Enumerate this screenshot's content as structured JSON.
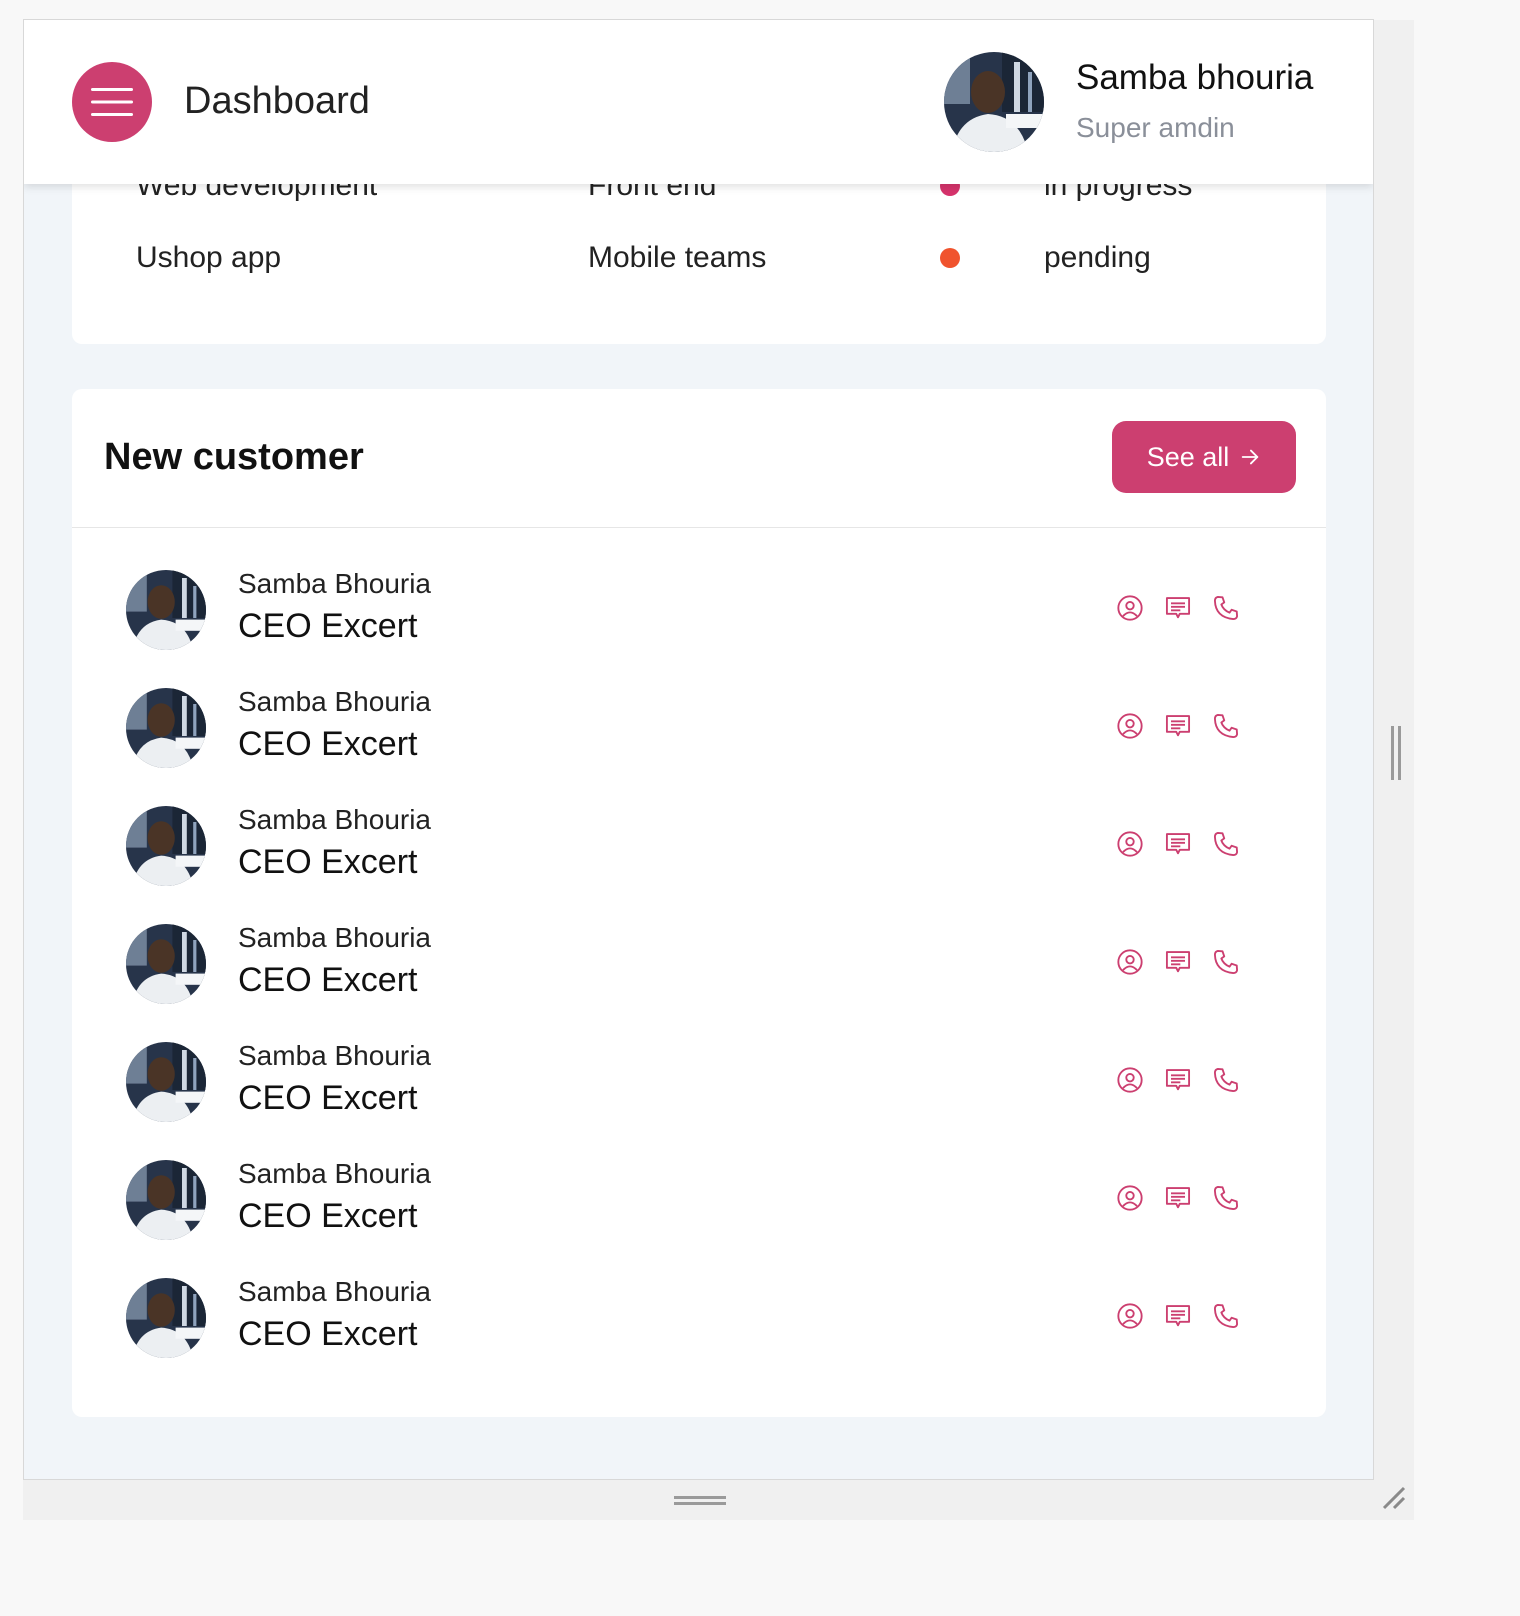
{
  "header": {
    "title": "Dashboard",
    "user": {
      "name": "Samba bhouria",
      "role": "Super amdin"
    }
  },
  "projects": {
    "rows": [
      {
        "name": "Web development",
        "department": "Front end",
        "status": "in progress",
        "status_color": "#d6336c"
      },
      {
        "name": "Ushop app",
        "department": "Mobile teams",
        "status": "pending",
        "status_color": "#f0532d"
      }
    ]
  },
  "customers": {
    "title": "New customer",
    "see_all_label": "See all",
    "list": [
      {
        "name": "Samba Bhouria",
        "role": "CEO Excert"
      },
      {
        "name": "Samba Bhouria",
        "role": "CEO Excert"
      },
      {
        "name": "Samba Bhouria",
        "role": "CEO Excert"
      },
      {
        "name": "Samba Bhouria",
        "role": "CEO Excert"
      },
      {
        "name": "Samba Bhouria",
        "role": "CEO Excert"
      },
      {
        "name": "Samba Bhouria",
        "role": "CEO Excert"
      },
      {
        "name": "Samba Bhouria",
        "role": "CEO Excert"
      }
    ],
    "actions": [
      "user-circle-icon",
      "message-icon",
      "phone-icon"
    ]
  },
  "colors": {
    "accent": "#cc3f70",
    "page_bg": "#f1f5f9"
  }
}
